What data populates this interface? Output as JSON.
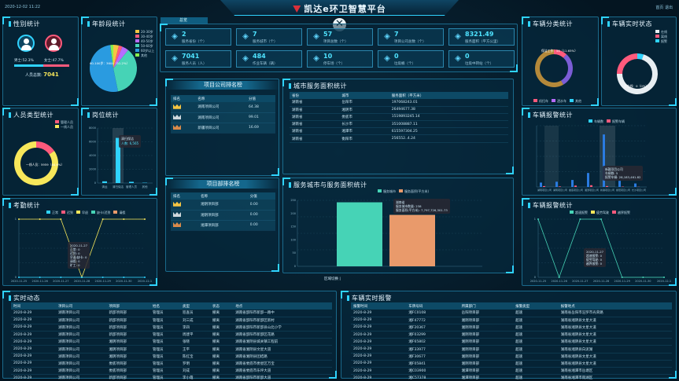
{
  "header": {
    "title": "凯达e环卫智慧平台",
    "datetime": "2020-12-02 11:22",
    "right": "首页  退出"
  },
  "tab": {
    "label": "总览"
  },
  "colors": {
    "accent": "#2fd3ff",
    "cyan": "#4fe3ff",
    "pink": "#ff5a7c",
    "yellow": "#f7e75a",
    "orange": "#e99a6b",
    "teal": "#46d3b6"
  },
  "panels": {
    "gender": "性别统计",
    "age": "年龄段统计",
    "staffType": "人员类型统计",
    "post": "岗位统计",
    "attendance": "考勤统计",
    "vehicleClass": "车辆分类统计",
    "vehicleStatus": "车辆实时状态",
    "vehicleFault": "车辆报警统计",
    "vehicleAlarm": "车辆报警统计",
    "companyRank": "项目公司排名榜",
    "deptRank": "项目部排名榜",
    "cityArea": "城市服务面积统计",
    "cityChart": "服务城市与服务面积统计",
    "realtime": "实时动态",
    "carRealtime": "车辆实时报警"
  },
  "gender": {
    "male_label": "男士:52.3%",
    "female_label": "女士:47.7%",
    "total_label": "人员总数:",
    "total": "7041"
  },
  "stats": [
    {
      "icon": "person-icon",
      "value": "2",
      "label": "服务省份（个）"
    },
    {
      "icon": "city-icon",
      "value": "7",
      "label": "服务城市（个）"
    },
    {
      "icon": "building-icon",
      "value": "57",
      "label": "项目总数（个）"
    },
    {
      "icon": "doc-icon",
      "value": "7",
      "label": "项目公司总数（个）"
    },
    {
      "icon": "area-icon",
      "value": "8321.49",
      "label": "服务面积（平方公里）"
    },
    {
      "icon": "people-icon",
      "value": "7041",
      "label": "服务人员（人）"
    },
    {
      "icon": "truck-icon",
      "value": "484",
      "label": "作业车辆（辆）"
    },
    {
      "icon": "bin-icon",
      "value": "10",
      "label": "停车场（个）"
    },
    {
      "icon": "toilet-icon",
      "value": "0",
      "label": "垃圾桶（个）"
    },
    {
      "icon": "station-icon",
      "value": "0",
      "label": "垃圾中转站（个）"
    }
  ],
  "companyRank": {
    "headers": [
      "排名",
      "名称",
      "分值"
    ],
    "rows": [
      {
        "name": "湖南项目公司",
        "score": "64.38",
        "color": "#f5c542"
      },
      {
        "name": "湖南项目公司",
        "score": "99.01",
        "color": "#cfd8dc"
      },
      {
        "name": "新疆项目公司",
        "score": "16.69",
        "color": "#d88a4a"
      }
    ]
  },
  "deptRank": {
    "headers": [
      "排名",
      "名称",
      "分值"
    ],
    "rows": [
      {
        "name": "湘阴项目部",
        "score": "0.00",
        "color": "#f5c542"
      },
      {
        "name": "湘阴项目部",
        "score": "0.00",
        "color": "#cfd8dc"
      },
      {
        "name": "湘潭项目部",
        "score": "0.00",
        "color": "#d88a4a"
      }
    ]
  },
  "cityArea": {
    "headers": [
      "省份",
      "城市",
      "服务面积（平方米）"
    ],
    "rows": [
      [
        "湖南省",
        "岳阳市",
        "197068243.01"
      ],
      [
        "湖南省",
        "湘阴市",
        "26494677.38"
      ],
      [
        "湖南省",
        "娄底市",
        "1519893245.14"
      ],
      [
        "湖南省",
        "长沙市",
        "351008887.11"
      ],
      [
        "湖南省",
        "湘潭市",
        "615597304.25"
      ],
      [
        "湖南省",
        "衡阳市",
        "256552..4.24"
      ]
    ]
  },
  "realtime": {
    "headers": [
      "时间",
      "项目公司",
      "项目部",
      "姓名",
      "类型",
      "状态",
      "地点"
    ],
    "rows": [
      [
        "2020-8-29",
        "湖南项目公司",
        "新邵项目部",
        "管理员",
        "巡查员",
        "撤离",
        "湖南省邵阳市新邵一路中"
      ],
      [
        "2020-8-29",
        "湖南项目公司",
        "新邵项目部",
        "管理员",
        "刘三成",
        "撤离",
        "湖南省邵阳市新邵区新村"
      ],
      [
        "2020-8-29",
        "湖南项目公司",
        "新邵项目部",
        "管理员",
        "李四",
        "撤离",
        "湖南省邵阳市新邵县山北小学"
      ],
      [
        "2020-8-29",
        "湖南项目公司",
        "新邵项目部",
        "管理员",
        "周建平",
        "撤离",
        "湖南省邵阳市新邵区花路"
      ],
      [
        "2020-8-29",
        "湖南项目公司",
        "湘阴项目部",
        "管理员",
        "张晓",
        "撤离",
        "湖南省湘阴县城关镇工程前"
      ],
      [
        "2020-8-29",
        "湖南项目公司",
        "湘阴项目部",
        "管理员",
        "王平",
        "撤离",
        "湖南省湘阴县文星大道"
      ],
      [
        "2020-8-29",
        "湖南项目公司",
        "湘阴项目部",
        "管理员",
        "陈红宝",
        "撤离",
        "湖南省湘阴县团结路"
      ],
      [
        "2020-8-29",
        "湖南项目公司",
        "娄底项目部",
        "管理员",
        "罗明",
        "撤离",
        "湖南省娄底市娄星区万宝"
      ],
      [
        "2020-8-29",
        "湖南项目公司",
        "娄底项目部",
        "管理员",
        "刘成",
        "撤离",
        "湖南省娄底市乐坪大道"
      ],
      [
        "2020-8-29",
        "湖南项目公司",
        "新邵项目部",
        "管理员",
        "李小霞",
        "撤离",
        "湖南省邵阳市新邵大道"
      ],
      [
        "2020-8-29",
        "湖南项目公司",
        "新邵项目部",
        "管理员",
        "周云",
        "撤离",
        "湖南省邵阳市大桥北路"
      ]
    ]
  },
  "carRealtime": {
    "headers": [
      "报警时间",
      "车牌号码",
      "所属部门",
      "报警类型",
      "报警地点"
    ],
    "rows": [
      [
        "2020-8-29",
        "湘FC0108",
        "岳阳项目部",
        "超速",
        "湖南省岳阳市汨罗市光荣路"
      ],
      [
        "2020-8-29",
        "湘F47772",
        "湘阴项目部",
        "超速",
        "湖南省湘阴县文星大道"
      ],
      [
        "2020-8-29",
        "湘F20367",
        "湘阴项目部",
        "超速",
        "湖南省湘阴县文星大道"
      ],
      [
        "2020-8-29",
        "湘F03299",
        "湘阴项目部",
        "超速",
        "湖南省湘阴县文星大道"
      ],
      [
        "2020-8-29",
        "湘F65802",
        "湘阴项目部",
        "超速",
        "湖南省湘阴县文星大道"
      ],
      [
        "2020-8-29",
        "湘F33977",
        "湘阴项目部",
        "超速",
        "湖南省湘阴县白泥湖"
      ],
      [
        "2020-8-29",
        "湘F30677",
        "湘阴项目部",
        "超速",
        "湖南省湘阴县文星大道"
      ],
      [
        "2020-8-29",
        "湘F05841",
        "湘阴项目部",
        "超速",
        "湖南省湘阴县文星大道"
      ],
      [
        "2020-8-29",
        "湘C03900",
        "湘潭项目部",
        "超速",
        "湖南省湘潭市岳塘区"
      ],
      [
        "2020-8-29",
        "湘C57378",
        "湘潭项目部",
        "超速",
        "湖南省湘潭市雨湖区"
      ],
      [
        "2020-8-29",
        "湘F08077",
        "湘阴项目部",
        "超速",
        "湖南省湘阴县文星大道"
      ]
    ]
  },
  "ageLegend": [
    "20-30岁",
    "30-40岁",
    "40-50岁",
    "50-60岁",
    "60岁以上",
    "其他"
  ],
  "ageSliceLabel": "60-100岁：3604（51.2%）",
  "staffTypeLegend": [
    "管理人员",
    "一线人员"
  ],
  "staffTypeLabel": "一线人员：5959（84.6%）",
  "postTooltip": {
    "title": "清扫保洁",
    "value": "人数: 6,565"
  },
  "attendanceLegend": [
    "正常",
    "迟到",
    "早退",
    "缺卡/迟到",
    "请假"
  ],
  "attendanceTooltip": {
    "date": "2020-11-27",
    "lines": [
      "正常: 0",
      "迟到: 0",
      "早退/缺卡: 0",
      "请假: 0",
      "旷工: 0"
    ]
  },
  "vehicleClassLabel": "保洁工作：56（11.65%）",
  "vehicleClassLegend": [
    "机扫车",
    "洒水车",
    "其他"
  ],
  "vehicleStatusLegend": [
    "在线",
    "离线",
    "报警"
  ],
  "vehicleStatusLabel": "总在线：0（0%）",
  "faultLegend": [
    "车辆数",
    "报警车辆"
  ],
  "faultTooltip": {
    "title": "新疆项目公司",
    "lines": [
      "车辆数: 5",
      "报警车辆: 28,183,461.82"
    ]
  },
  "alarmLegend": [
    "超速报警",
    "疲劳驾驶",
    "越界报警"
  ],
  "alarmTooltip": {
    "date": "2020-11-27",
    "lines": [
      "超速报警: 0",
      "疲劳驾驶: 0",
      "越界报警: 0"
    ]
  },
  "cityChartTooltip": {
    "title": "湖南省",
    "lines": [
      "服务城市数量: 238",
      "服务面积(平方米): 7,797,726,301.73"
    ]
  },
  "cityChartLegend": [
    "服务城市",
    "服务面积(平方米)"
  ],
  "cityChartFooter": "区域切换 |",
  "chart_data": [
    {
      "type": "pie",
      "title": "性别统计",
      "categories": [
        "男",
        "女"
      ],
      "values": [
        52.3,
        47.7
      ]
    },
    {
      "type": "pie",
      "title": "年龄段统计",
      "categories": [
        "20-30岁",
        "30-40岁",
        "40-50岁",
        "50-60岁",
        "60岁以上",
        "其他"
      ],
      "values": [
        3.8,
        2.5,
        4.6,
        35.9,
        51.2,
        2.0
      ]
    },
    {
      "type": "pie",
      "title": "人员类型统计",
      "categories": [
        "管理人员",
        "一线人员"
      ],
      "values": [
        15.4,
        84.6
      ]
    },
    {
      "type": "bar",
      "title": "岗位统计",
      "categories": [
        "清运",
        "清扫保洁",
        "管理人员",
        "其他"
      ],
      "values": [
        250,
        6565,
        180,
        46
      ],
      "ylim": [
        0,
        8000
      ]
    },
    {
      "type": "line",
      "title": "考勤统计",
      "x": [
        "2020-11-25",
        "2020-11-26",
        "2020-11-27",
        "2020-11-28",
        "2020-11-29",
        "2020-11-30",
        "2020-12-1"
      ],
      "series": [
        {
          "name": "正常",
          "values": [
            1,
            1,
            1,
            0,
            1,
            1,
            1
          ]
        },
        {
          "name": "迟到",
          "values": [
            0,
            0,
            0,
            0,
            0,
            0,
            0
          ]
        }
      ],
      "ylim": [
        0,
        1
      ]
    },
    {
      "type": "pie",
      "title": "车辆分类统计",
      "categories": [
        "保洁工作",
        "机扫",
        "洒水"
      ],
      "values": [
        11.65,
        30,
        58.35
      ]
    },
    {
      "type": "pie",
      "title": "车辆实时状态",
      "categories": [
        "在线",
        "离线",
        "报警"
      ],
      "values": [
        5,
        70,
        25
      ]
    },
    {
      "type": "bar",
      "title": "车辆报警统计",
      "categories": [
        "湖南项目公司",
        "湖南项目公司",
        "娄底项目公司",
        "湘潭项目公司",
        "新疆项目公司",
        "衡阳项目公司",
        "长沙项目公司"
      ],
      "series": [
        {
          "name": "车辆数",
          "values": [
            25,
            30,
            40,
            80,
            300,
            35,
            20
          ]
        },
        {
          "name": "报警车辆",
          "values": [
            5,
            3,
            8,
            10,
            5,
            2,
            1
          ]
        }
      ],
      "ylim": [
        0,
        350
      ]
    },
    {
      "type": "bar",
      "title": "服务城市与服务面积统计",
      "categories": [
        "湖南省",
        "新疆"
      ],
      "series": [
        {
          "name": "服务城市",
          "values": [
            238,
            0
          ]
        },
        {
          "name": "服务面积(平方米)",
          "values": [
            0,
            7797726301.73
          ]
        }
      ],
      "ylim": [
        0,
        250
      ]
    },
    {
      "type": "line",
      "title": "车辆报警统计",
      "x": [
        "2020-11-25",
        "2020-11-26",
        "2020-11-27",
        "2020-11-28",
        "2020-11-29",
        "2020-11-30",
        "2020-12-1"
      ],
      "series": [
        {
          "name": "超速报警",
          "values": [
            1,
            0,
            1,
            1,
            0,
            0,
            0
          ]
        }
      ],
      "ylim": [
        0,
        1
      ]
    }
  ]
}
